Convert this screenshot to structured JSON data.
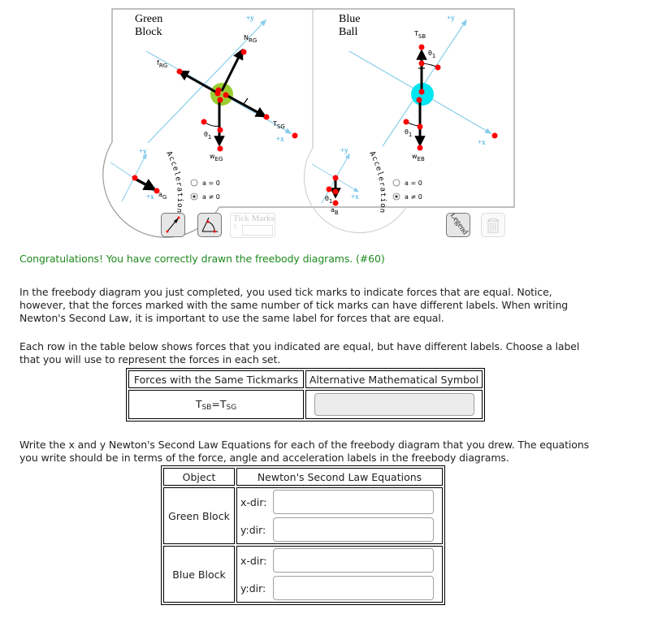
{
  "diagram": {
    "green_panel": {
      "title_line1": "Green",
      "title_line2": "Block",
      "axis_x_label": "+x",
      "axis_y_label": "+y",
      "body_color": "#9acd32",
      "forces": [
        {
          "label": "N",
          "sub": "RG"
        },
        {
          "label": "f",
          "sub": "RG"
        },
        {
          "label": "T",
          "sub": "SG"
        },
        {
          "label": "w",
          "sub": "EG"
        }
      ],
      "angle_label": "θ",
      "angle_sub": "1",
      "acceleration_label": "a",
      "acceleration_sub": "G",
      "acceleration_arc_text": "Acceleration",
      "radio_a_zero": "a = 0",
      "radio_a_nonzero": "a ≠ 0",
      "selected_option": "a ≠ 0"
    },
    "blue_panel": {
      "title_line1": "Blue",
      "title_line2": "Ball",
      "axis_x_label": "+x",
      "axis_y_label": "+y",
      "body_color": "#00e5f0",
      "forces": [
        {
          "label": "T",
          "sub": "SB"
        },
        {
          "label": "w",
          "sub": "EB"
        }
      ],
      "angle_label": "θ",
      "angle_sub": "1",
      "acceleration_label": "a",
      "acceleration_sub": "B",
      "acceleration_arc_text": "Acceleration",
      "radio_a_zero": "a = 0",
      "radio_a_nonzero": "a ≠ 0",
      "selected_option": "a ≠ 0"
    },
    "toolbar": {
      "vector_tool": "vector-arrow-icon",
      "angle_tool": "angle-icon",
      "tick_marks_label": "Tick Marks",
      "legend_label": "Legend",
      "trash_tool": "trash-icon"
    },
    "colors": {
      "axis": "#87ceeb",
      "axis_label": "#1ea0e0",
      "point": "#ff0000",
      "vector": "#000000"
    }
  },
  "feedback": {
    "congrats": "Congratulations! You have correctly drawn the freebody diagrams. (#60)",
    "color": "#1e8a1e"
  },
  "intro": {
    "paragraph1": "In the freebody diagram you just completed, you used tick marks to indicate forces that are equal. Notice, however, that the forces marked with the same number of tick marks can have different labels. When writing Newton's Second Law, it is important to use the same label for forces that are equal.",
    "paragraph2": "Each row in the table below shows forces that you indicated are equal, but have different labels. Choose a label that you will use to represent the forces in each set."
  },
  "tick_table": {
    "headers": [
      "Forces with the Same Tickmarks",
      "Alternative Mathematical Symbol"
    ],
    "rows": [
      {
        "f1": "T",
        "f1_sub": "SB",
        "eq": "=",
        "f2": "T",
        "f2_sub": "SG",
        "symbol_value": ""
      }
    ]
  },
  "equations_intro": "Write the x and y Newton's Second Law Equations for each of the freebody diagram that you drew. The equations you write should be in terms of the force, angle and acceleration labels in the freebody diagrams.",
  "eq_table": {
    "headers": [
      "Object",
      "Newton's Second Law Equations"
    ],
    "rows": [
      {
        "object": "Green Block",
        "x_label": "x-dir:",
        "y_label": "y:dir:",
        "x_value": "",
        "y_value": ""
      },
      {
        "object": "Blue Block",
        "x_label": "x-dir:",
        "y_label": "y:dir:",
        "x_value": "",
        "y_value": ""
      }
    ]
  }
}
